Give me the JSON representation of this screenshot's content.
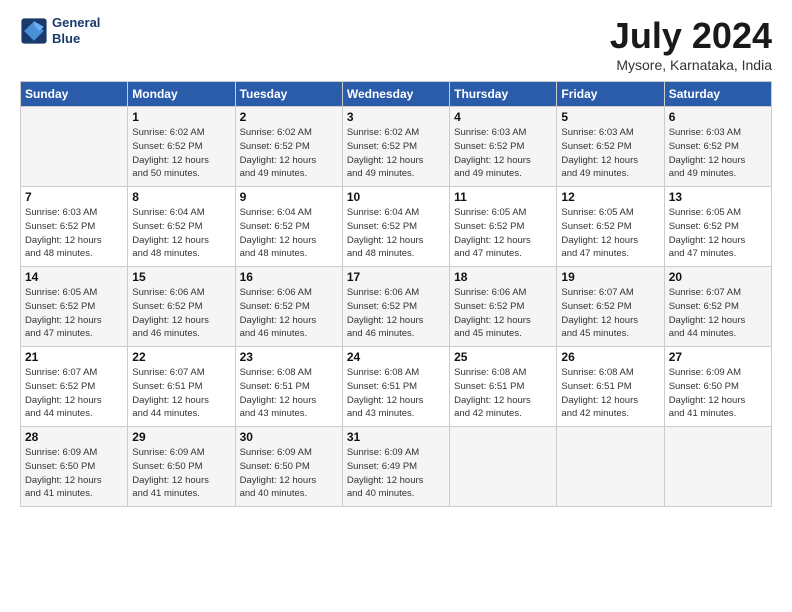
{
  "header": {
    "logo_line1": "General",
    "logo_line2": "Blue",
    "month_title": "July 2024",
    "location": "Mysore, Karnataka, India"
  },
  "days_of_week": [
    "Sunday",
    "Monday",
    "Tuesday",
    "Wednesday",
    "Thursday",
    "Friday",
    "Saturday"
  ],
  "weeks": [
    [
      {
        "num": "",
        "info": ""
      },
      {
        "num": "1",
        "info": "Sunrise: 6:02 AM\nSunset: 6:52 PM\nDaylight: 12 hours\nand 50 minutes."
      },
      {
        "num": "2",
        "info": "Sunrise: 6:02 AM\nSunset: 6:52 PM\nDaylight: 12 hours\nand 49 minutes."
      },
      {
        "num": "3",
        "info": "Sunrise: 6:02 AM\nSunset: 6:52 PM\nDaylight: 12 hours\nand 49 minutes."
      },
      {
        "num": "4",
        "info": "Sunrise: 6:03 AM\nSunset: 6:52 PM\nDaylight: 12 hours\nand 49 minutes."
      },
      {
        "num": "5",
        "info": "Sunrise: 6:03 AM\nSunset: 6:52 PM\nDaylight: 12 hours\nand 49 minutes."
      },
      {
        "num": "6",
        "info": "Sunrise: 6:03 AM\nSunset: 6:52 PM\nDaylight: 12 hours\nand 49 minutes."
      }
    ],
    [
      {
        "num": "7",
        "info": "Sunrise: 6:03 AM\nSunset: 6:52 PM\nDaylight: 12 hours\nand 48 minutes."
      },
      {
        "num": "8",
        "info": "Sunrise: 6:04 AM\nSunset: 6:52 PM\nDaylight: 12 hours\nand 48 minutes."
      },
      {
        "num": "9",
        "info": "Sunrise: 6:04 AM\nSunset: 6:52 PM\nDaylight: 12 hours\nand 48 minutes."
      },
      {
        "num": "10",
        "info": "Sunrise: 6:04 AM\nSunset: 6:52 PM\nDaylight: 12 hours\nand 48 minutes."
      },
      {
        "num": "11",
        "info": "Sunrise: 6:05 AM\nSunset: 6:52 PM\nDaylight: 12 hours\nand 47 minutes."
      },
      {
        "num": "12",
        "info": "Sunrise: 6:05 AM\nSunset: 6:52 PM\nDaylight: 12 hours\nand 47 minutes."
      },
      {
        "num": "13",
        "info": "Sunrise: 6:05 AM\nSunset: 6:52 PM\nDaylight: 12 hours\nand 47 minutes."
      }
    ],
    [
      {
        "num": "14",
        "info": "Sunrise: 6:05 AM\nSunset: 6:52 PM\nDaylight: 12 hours\nand 47 minutes."
      },
      {
        "num": "15",
        "info": "Sunrise: 6:06 AM\nSunset: 6:52 PM\nDaylight: 12 hours\nand 46 minutes."
      },
      {
        "num": "16",
        "info": "Sunrise: 6:06 AM\nSunset: 6:52 PM\nDaylight: 12 hours\nand 46 minutes."
      },
      {
        "num": "17",
        "info": "Sunrise: 6:06 AM\nSunset: 6:52 PM\nDaylight: 12 hours\nand 46 minutes."
      },
      {
        "num": "18",
        "info": "Sunrise: 6:06 AM\nSunset: 6:52 PM\nDaylight: 12 hours\nand 45 minutes."
      },
      {
        "num": "19",
        "info": "Sunrise: 6:07 AM\nSunset: 6:52 PM\nDaylight: 12 hours\nand 45 minutes."
      },
      {
        "num": "20",
        "info": "Sunrise: 6:07 AM\nSunset: 6:52 PM\nDaylight: 12 hours\nand 44 minutes."
      }
    ],
    [
      {
        "num": "21",
        "info": "Sunrise: 6:07 AM\nSunset: 6:52 PM\nDaylight: 12 hours\nand 44 minutes."
      },
      {
        "num": "22",
        "info": "Sunrise: 6:07 AM\nSunset: 6:51 PM\nDaylight: 12 hours\nand 44 minutes."
      },
      {
        "num": "23",
        "info": "Sunrise: 6:08 AM\nSunset: 6:51 PM\nDaylight: 12 hours\nand 43 minutes."
      },
      {
        "num": "24",
        "info": "Sunrise: 6:08 AM\nSunset: 6:51 PM\nDaylight: 12 hours\nand 43 minutes."
      },
      {
        "num": "25",
        "info": "Sunrise: 6:08 AM\nSunset: 6:51 PM\nDaylight: 12 hours\nand 42 minutes."
      },
      {
        "num": "26",
        "info": "Sunrise: 6:08 AM\nSunset: 6:51 PM\nDaylight: 12 hours\nand 42 minutes."
      },
      {
        "num": "27",
        "info": "Sunrise: 6:09 AM\nSunset: 6:50 PM\nDaylight: 12 hours\nand 41 minutes."
      }
    ],
    [
      {
        "num": "28",
        "info": "Sunrise: 6:09 AM\nSunset: 6:50 PM\nDaylight: 12 hours\nand 41 minutes."
      },
      {
        "num": "29",
        "info": "Sunrise: 6:09 AM\nSunset: 6:50 PM\nDaylight: 12 hours\nand 41 minutes."
      },
      {
        "num": "30",
        "info": "Sunrise: 6:09 AM\nSunset: 6:50 PM\nDaylight: 12 hours\nand 40 minutes."
      },
      {
        "num": "31",
        "info": "Sunrise: 6:09 AM\nSunset: 6:49 PM\nDaylight: 12 hours\nand 40 minutes."
      },
      {
        "num": "",
        "info": ""
      },
      {
        "num": "",
        "info": ""
      },
      {
        "num": "",
        "info": ""
      }
    ]
  ]
}
